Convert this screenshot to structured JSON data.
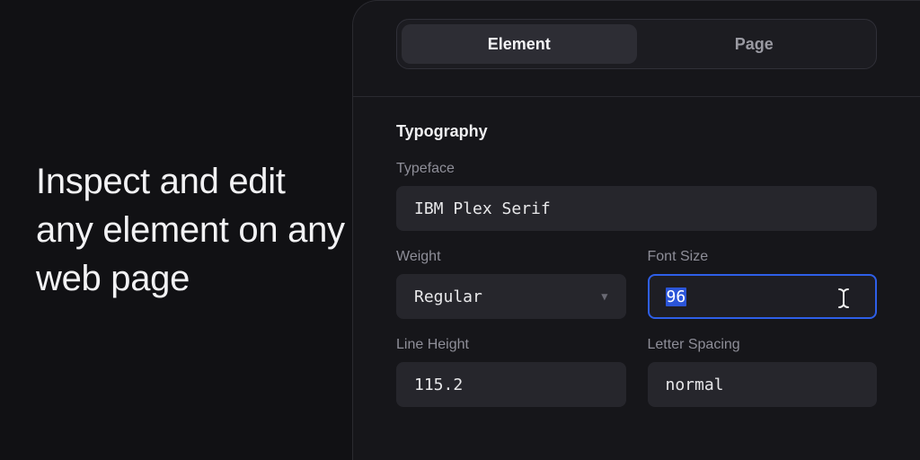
{
  "tagline": "Inspect and edit any element on any web page",
  "tabs": {
    "element": "Element",
    "page": "Page"
  },
  "typography": {
    "section_title": "Typography",
    "typeface": {
      "label": "Typeface",
      "value": "IBM Plex Serif"
    },
    "weight": {
      "label": "Weight",
      "value": "Regular"
    },
    "font_size": {
      "label": "Font Size",
      "value": "96"
    },
    "line_height": {
      "label": "Line Height",
      "value": "115.2"
    },
    "letter_spacing": {
      "label": "Letter Spacing",
      "value": "normal"
    }
  }
}
